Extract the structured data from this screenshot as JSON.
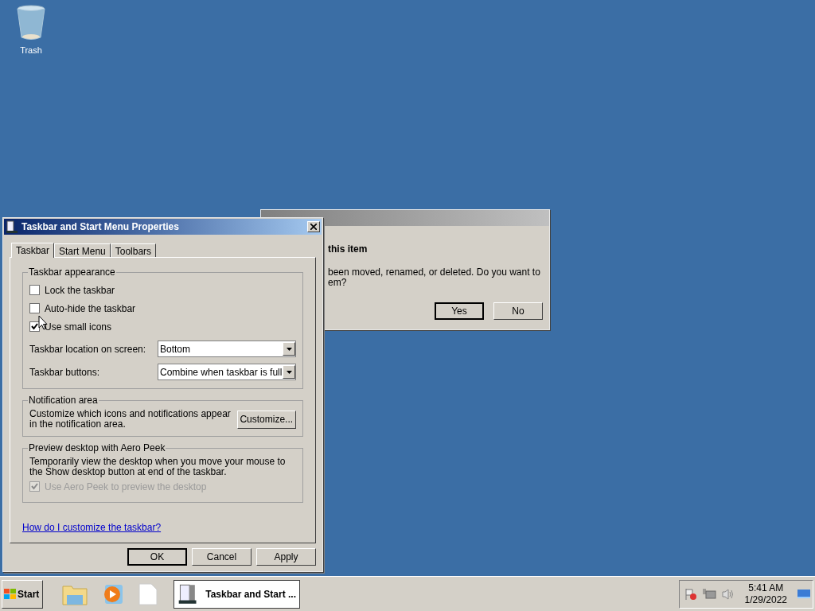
{
  "desktop": {
    "icons": [
      {
        "label": "Trash"
      }
    ]
  },
  "back_dialog": {
    "heading": "this item",
    "message": "been moved, renamed, or deleted. Do you want to\nem?",
    "buttons": [
      {
        "label": "Yes",
        "default": true
      },
      {
        "label": "No",
        "default": false
      }
    ]
  },
  "window": {
    "title": "Taskbar and Start Menu Properties",
    "tabs": [
      {
        "label": "Taskbar",
        "selected": true
      },
      {
        "label": "Start Menu",
        "selected": false
      },
      {
        "label": "Toolbars",
        "selected": false
      }
    ],
    "appearance": {
      "title": "Taskbar appearance",
      "checkboxes": [
        {
          "label": "Lock the taskbar",
          "checked": false
        },
        {
          "label": "Auto-hide the taskbar",
          "checked": false
        },
        {
          "label": "Use small icons",
          "checked": true
        }
      ],
      "selects": [
        {
          "label": "Taskbar location on screen:",
          "value": "Bottom"
        },
        {
          "label": "Taskbar buttons:",
          "value": "Combine when taskbar is full"
        }
      ]
    },
    "notification": {
      "title": "Notification area",
      "text": "Customize which icons and notifications appear in the notification area.",
      "button": "Customize..."
    },
    "peek": {
      "title": "Preview desktop with Aero Peek",
      "text": "Temporarily view the desktop when you move your mouse to the Show desktop button at end of the taskbar.",
      "checkbox": {
        "label": "Use Aero Peek to preview the desktop",
        "checked": true,
        "disabled": true
      }
    },
    "link": "How do I customize the taskbar?",
    "buttons": [
      {
        "label": "OK",
        "default": true
      },
      {
        "label": "Cancel",
        "default": false
      },
      {
        "label": "Apply",
        "default": false
      }
    ]
  },
  "taskbar": {
    "start": "Start",
    "task_button": {
      "label": "Taskbar and Start ...",
      "selected": true
    },
    "clock": {
      "time": "5:41 AM",
      "date": "1/29/2022"
    }
  }
}
